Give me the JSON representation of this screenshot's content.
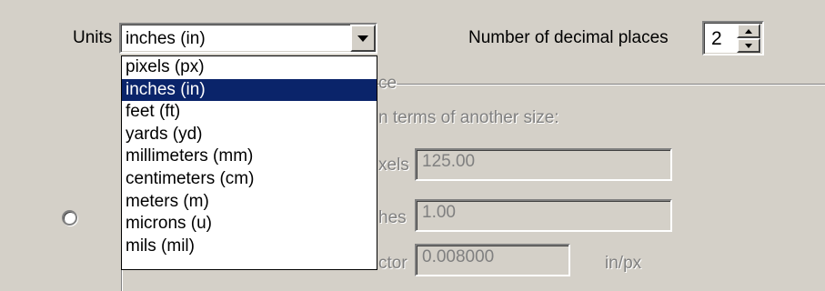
{
  "units": {
    "label": "Units",
    "selected": "inches (in)",
    "options": [
      "pixels (px)",
      "inches (in)",
      "feet (ft)",
      "yards (yd)",
      "millimeters (mm)",
      "centimeters (cm)",
      "meters (m)",
      "microns (u)",
      "mils (mil)"
    ],
    "selected_index": 1
  },
  "decimals": {
    "label": "Number of decimal places",
    "value": "2"
  },
  "group": {
    "title_partial": "ce",
    "description_partial": "n terms of another size:",
    "rows": [
      {
        "label_partial": "xels",
        "value": "125.00",
        "unit": ""
      },
      {
        "label_partial": "hes",
        "value": "1.00",
        "unit": ""
      },
      {
        "label_partial": "ctor",
        "value": "0.008000",
        "unit": "in/px"
      }
    ]
  },
  "colors": {
    "face": "#d4d0c8",
    "selection": "#0a246a",
    "disabled_text": "#808080"
  }
}
